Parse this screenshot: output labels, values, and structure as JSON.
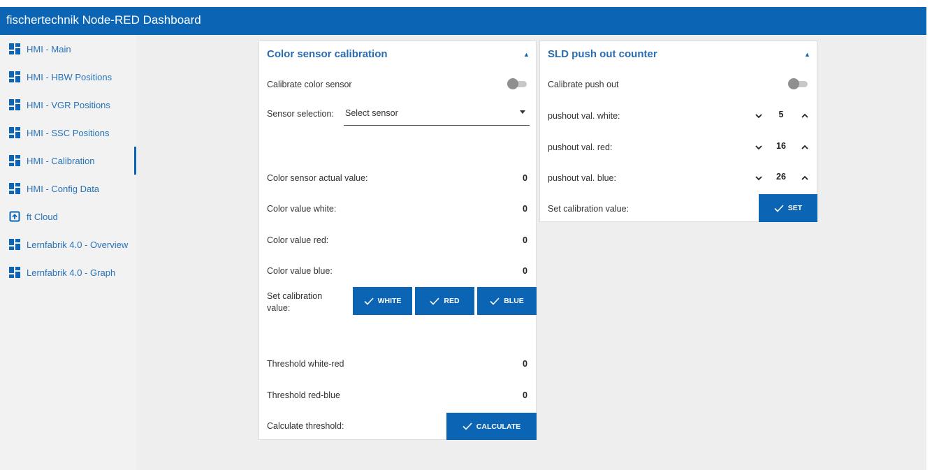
{
  "header": {
    "title": "fischertechnik Node-RED Dashboard"
  },
  "sidebar": {
    "items": [
      {
        "label": "HMI - Main",
        "icon": "dashboard-icon"
      },
      {
        "label": "HMI - HBW Positions",
        "icon": "dashboard-icon"
      },
      {
        "label": "HMI - VGR Positions",
        "icon": "dashboard-icon"
      },
      {
        "label": "HMI - SSC Positions",
        "icon": "dashboard-icon"
      },
      {
        "label": "HMI - Calibration",
        "icon": "dashboard-icon",
        "active": true
      },
      {
        "label": "HMI - Config Data",
        "icon": "dashboard-icon"
      },
      {
        "label": "ft Cloud",
        "icon": "open-in-new-icon"
      },
      {
        "label": "Lernfabrik 4.0 - Overview",
        "icon": "dashboard-icon"
      },
      {
        "label": "Lernfabrik 4.0 - Graph",
        "icon": "dashboard-icon"
      }
    ]
  },
  "color_card": {
    "title": "Color sensor calibration",
    "calibrate_label": "Calibrate color sensor",
    "calibrate_on": false,
    "sensor_label": "Sensor selection:",
    "sensor_placeholder": "Select sensor",
    "actual_label": "Color sensor actual value:",
    "actual_value": "0",
    "white_label": "Color value white:",
    "white_value": "0",
    "red_label": "Color value red:",
    "red_value": "0",
    "blue_label": "Color value blue:",
    "blue_value": "0",
    "set_label": "Set calibration value:",
    "btn_white": "WHITE",
    "btn_red": "RED",
    "btn_blue": "BLUE",
    "thr_wr_label": "Threshold white-red",
    "thr_wr_value": "0",
    "thr_rb_label": "Threshold red-blue",
    "thr_rb_value": "0",
    "calc_label": "Calculate threshold:",
    "btn_calc": "CALCULATE"
  },
  "sld_card": {
    "title": "SLD push out counter",
    "calibrate_label": "Calibrate push out",
    "calibrate_on": false,
    "white_label": "pushout val. white:",
    "white_value": "5",
    "red_label": "pushout val. red:",
    "red_value": "16",
    "blue_label": "pushout val. blue:",
    "blue_value": "26",
    "set_label": "Set calibration value:",
    "btn_set": "SET"
  },
  "colors": {
    "accent": "#0b65b4",
    "sidebar_bg": "#f2f2f2",
    "content_bg": "#eeeeee"
  }
}
